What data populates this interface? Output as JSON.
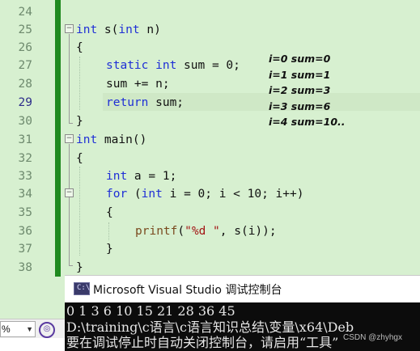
{
  "editor": {
    "line_numbers": [
      "24",
      "25",
      "26",
      "27",
      "28",
      "29",
      "30",
      "31",
      "32",
      "33",
      "34",
      "35",
      "36",
      "37",
      "38"
    ],
    "current_line": "29"
  },
  "code": {
    "l25": {
      "kw1": "int",
      "name": " s(",
      "kw2": "int",
      "rest": " n)"
    },
    "l26": "{",
    "l27": {
      "kw1": "static",
      "sp": " ",
      "kw2": "int",
      "rest": " sum = 0;"
    },
    "l28": "sum += n;",
    "l29": {
      "kw": "return",
      "rest": " sum;"
    },
    "l30": "}",
    "l31": {
      "kw": "int",
      "rest": " main()"
    },
    "l32": "{",
    "l33": {
      "kw": "int",
      "rest": " a = 1;"
    },
    "l34": {
      "kw1": "for",
      "mid": " (",
      "kw2": "int",
      "rest": " i = 0; i < 10; i++)"
    },
    "l35": "{",
    "l36": {
      "fn": "printf",
      "open": "(",
      "str": "\"%d \"",
      "rest": ", s(i));"
    },
    "l37": "}",
    "l38": "}"
  },
  "annotations": [
    "i=0 sum=0",
    "i=1 sum=1",
    "i=2 sum=3",
    "i=3 sum=6",
    "i=4 sum=10.."
  ],
  "console": {
    "title": "Microsoft Visual Studio 调试控制台",
    "lines": [
      "0 1 3 6 10 15 21 28 36 45",
      "D:\\training\\c语言\\c语言知识总结\\变量\\x64\\Deb",
      "要在调试停止时自动关闭控制台，请启用“工具”"
    ]
  },
  "status": {
    "zoom": "%"
  },
  "watermark": "CSDN @zhyhgx",
  "colors": {
    "editor_bg": "#d7f0d0",
    "keyword": "#1f2fd6",
    "string": "#a31515",
    "change_bar": "#1f8a1f",
    "console_bg": "#0c0c0c"
  }
}
